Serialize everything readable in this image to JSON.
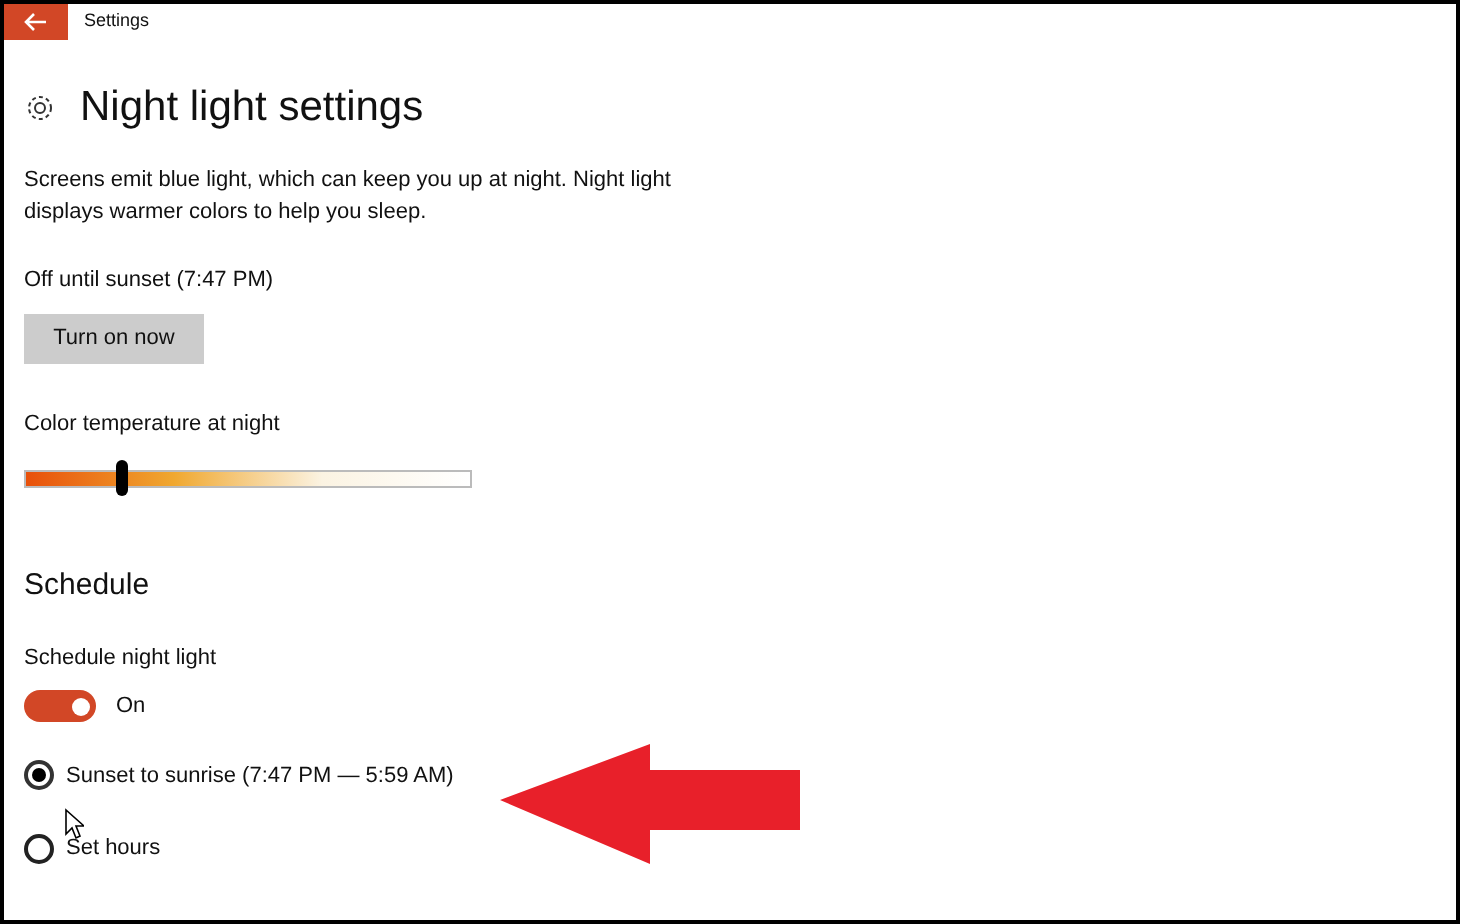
{
  "window": {
    "title": "Settings"
  },
  "heading": "Night light settings",
  "description": "Screens emit blue light, which can keep you up at night. Night light displays warmer colors to help you sleep.",
  "status": "Off until sunset (7:47 PM)",
  "turn_on_button": "Turn on now",
  "color_temperature": {
    "label": "Color temperature at night",
    "level": 0.22
  },
  "schedule": {
    "title": "Schedule",
    "toggle_label": "Schedule night light",
    "on": true,
    "toggle_text": "On",
    "options": [
      {
        "label": "Sunset to sunrise (7:47 PM — 5:59 AM)",
        "selected": true
      },
      {
        "label": "Set hours",
        "selected": false
      }
    ]
  }
}
